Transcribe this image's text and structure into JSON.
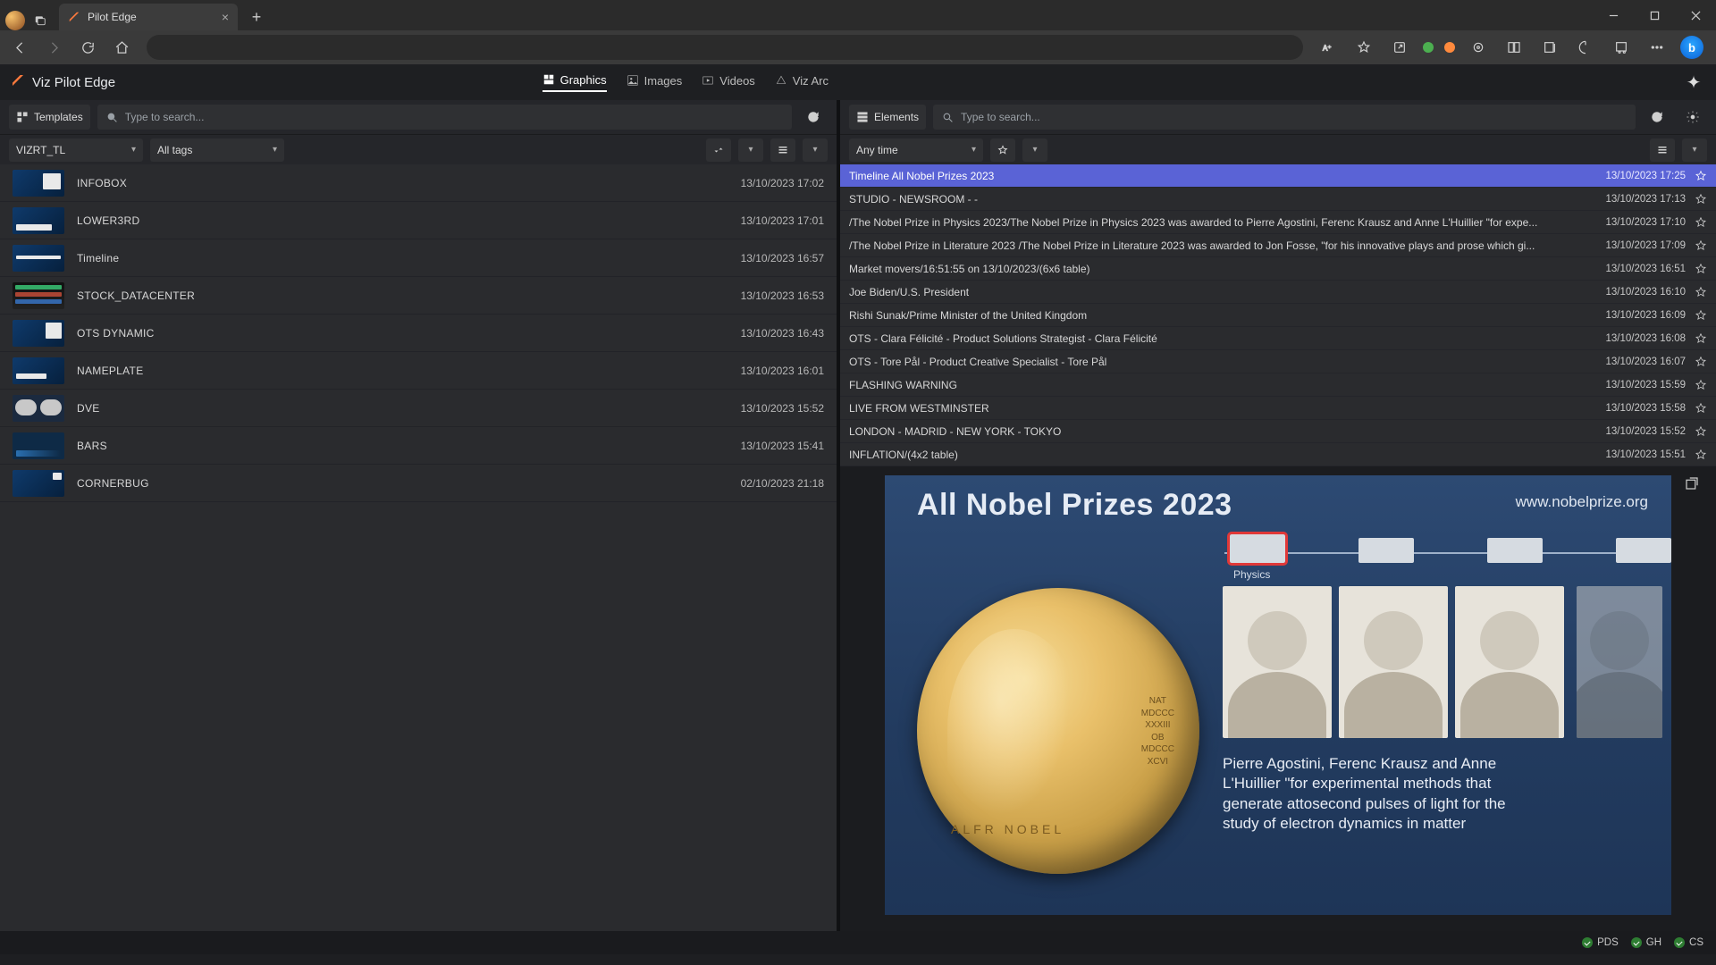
{
  "browser": {
    "tab_title": "Pilot Edge",
    "window_buttons": {
      "min": "min",
      "max": "max",
      "close": "close"
    }
  },
  "app": {
    "title": "Viz Pilot Edge",
    "tabs": [
      {
        "label": "Graphics",
        "active": true
      },
      {
        "label": "Images",
        "active": false
      },
      {
        "label": "Videos",
        "active": false
      },
      {
        "label": "Viz Arc",
        "active": false
      }
    ]
  },
  "left": {
    "templates_btn": "Templates",
    "search_placeholder": "Type to search...",
    "concept_dropdown": "VIZRT_TL",
    "tags_dropdown": "All tags",
    "templates": [
      {
        "name": "INFOBOX",
        "time": "13/10/2023 17:02",
        "thumb": "infobox"
      },
      {
        "name": "LOWER3RD",
        "time": "13/10/2023 17:01",
        "thumb": "lower3rd"
      },
      {
        "name": "Timeline",
        "time": "13/10/2023 16:57",
        "thumb": "timeline"
      },
      {
        "name": "STOCK_DATACENTER",
        "time": "13/10/2023 16:53",
        "thumb": "stock"
      },
      {
        "name": "OTS DYNAMIC",
        "time": "13/10/2023 16:43",
        "thumb": "ots"
      },
      {
        "name": "NAMEPLATE",
        "time": "13/10/2023 16:01",
        "thumb": "nameplate"
      },
      {
        "name": "DVE",
        "time": "13/10/2023 15:52",
        "thumb": "dve"
      },
      {
        "name": "BARS",
        "time": "13/10/2023 15:41",
        "thumb": "bars"
      },
      {
        "name": "CORNERBUG",
        "time": "02/10/2023 21:18",
        "thumb": "corner"
      }
    ]
  },
  "right": {
    "elements_btn": "Elements",
    "search_placeholder": "Type to search...",
    "time_dropdown": "Any time",
    "elements": [
      {
        "title": "Timeline All Nobel Prizes 2023",
        "time": "13/10/2023 17:25",
        "selected": true
      },
      {
        "title": "STUDIO - NEWSROOM - -",
        "time": "13/10/2023 17:13"
      },
      {
        "title": "/The Nobel Prize in Physics 2023/The Nobel Prize in Physics 2023 was awarded to Pierre Agostini, Ferenc Krausz and Anne L'Huillier \"for expe...",
        "time": "13/10/2023 17:10"
      },
      {
        "title": "/The Nobel Prize in Literature 2023 /The Nobel Prize in Literature 2023 was awarded to Jon Fosse, \"for his innovative plays and prose which gi...",
        "time": "13/10/2023 17:09"
      },
      {
        "title": "Market movers/16:51:55 on 13/10/2023/(6x6 table)",
        "time": "13/10/2023 16:51"
      },
      {
        "title": "Joe Biden/U.S. President",
        "time": "13/10/2023 16:10"
      },
      {
        "title": "Rishi Sunak/Prime Minister of the United Kingdom",
        "time": "13/10/2023 16:09"
      },
      {
        "title": "OTS - Clara Félicité - Product Solutions Strategist - Clara Félicité",
        "time": "13/10/2023 16:08"
      },
      {
        "title": "OTS - Tore Pål - Product Creative Specialist - Tore Pål",
        "time": "13/10/2023 16:07"
      },
      {
        "title": "FLASHING WARNING",
        "time": "13/10/2023 15:59"
      },
      {
        "title": "LIVE FROM WESTMINSTER",
        "time": "13/10/2023 15:58"
      },
      {
        "title": "LONDON - MADRID - NEW YORK - TOKYO",
        "time": "13/10/2023 15:52"
      },
      {
        "title": "INFLATION/(4x2 table)",
        "time": "13/10/2023 15:51"
      }
    ]
  },
  "preview": {
    "title": "All Nobel Prizes 2023",
    "source": "www.nobelprize.org",
    "timeline_caption": "Physics",
    "caption": "Pierre Agostini, Ferenc Krausz and Anne L'Huillier \"for experimental methods that generate attosecond pulses of light for the study of electron dynamics in matter",
    "medal_name": "ALFR   NOBEL",
    "medal_side": "NAT\nMDCCC\nXXXIII\nOB\nMDCCC\nXCVI"
  },
  "status": {
    "items": [
      {
        "label": "PDS"
      },
      {
        "label": "GH"
      },
      {
        "label": "CS"
      }
    ]
  }
}
